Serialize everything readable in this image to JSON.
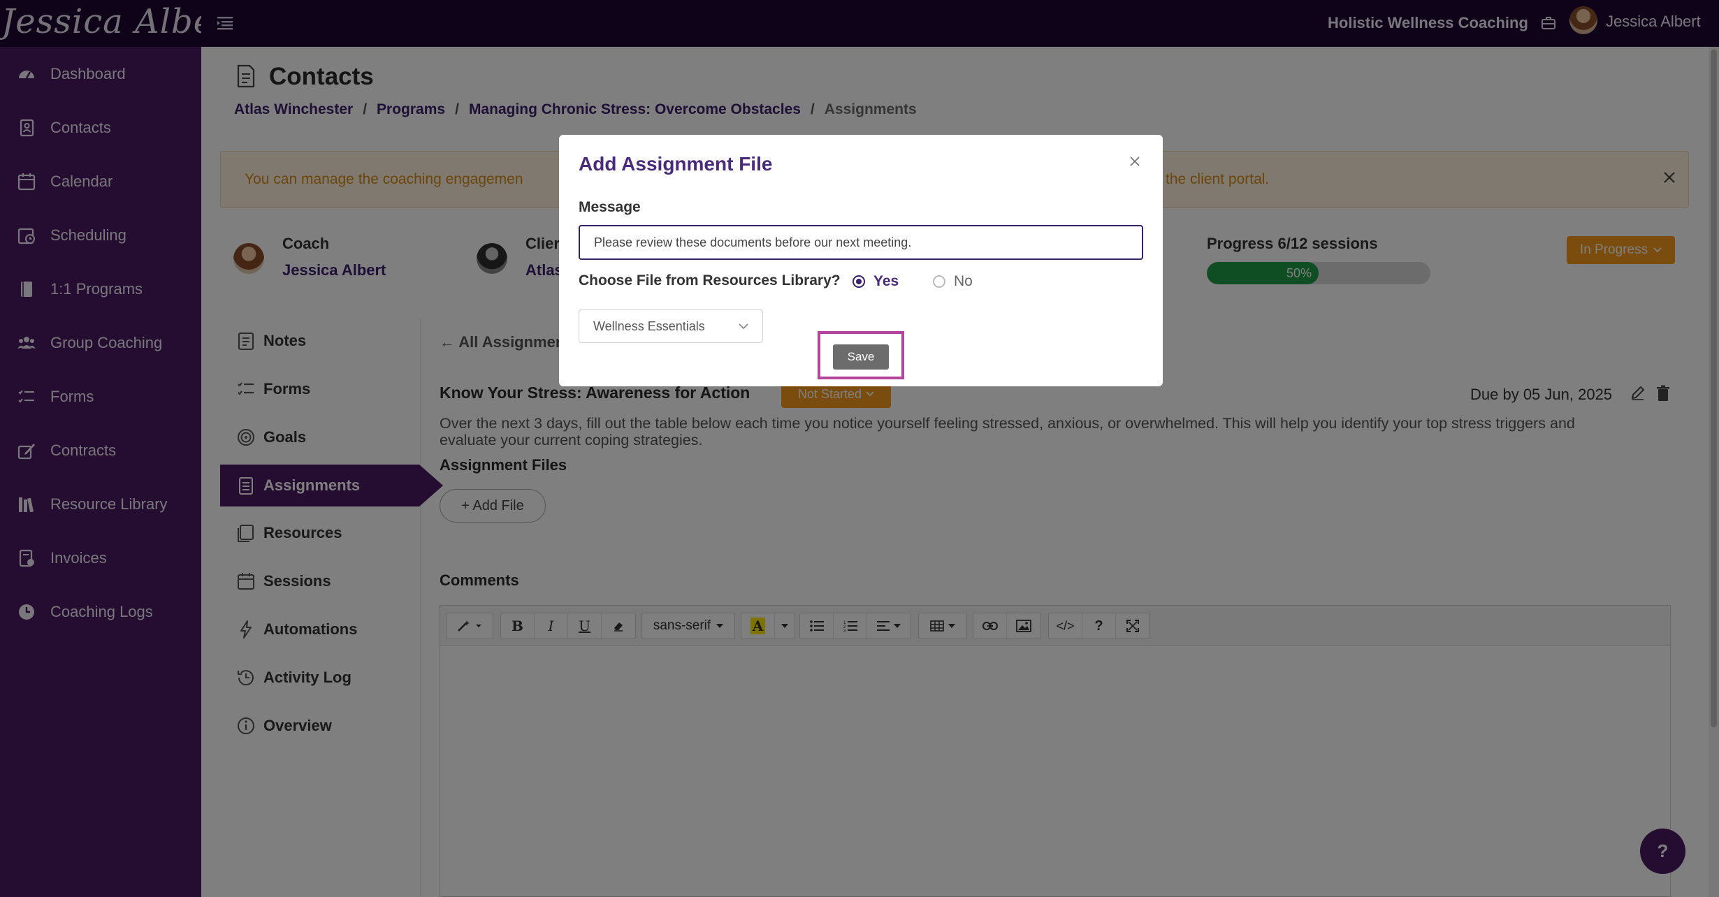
{
  "topbar": {
    "logo_text": "Jessica Albert",
    "org_name": "Holistic Wellness Coaching",
    "user_name": "Jessica Albert"
  },
  "sidebar": {
    "items": [
      {
        "label": "Dashboard",
        "icon": "dashboard-icon"
      },
      {
        "label": "Contacts",
        "icon": "contacts-icon"
      },
      {
        "label": "Calendar",
        "icon": "calendar-icon"
      },
      {
        "label": "Scheduling",
        "icon": "scheduling-icon"
      },
      {
        "label": "1:1 Programs",
        "icon": "book-icon"
      },
      {
        "label": "Group Coaching",
        "icon": "group-icon"
      },
      {
        "label": "Forms",
        "icon": "forms-icon"
      },
      {
        "label": "Contracts",
        "icon": "contract-icon"
      },
      {
        "label": "Resource Library",
        "icon": "library-icon"
      },
      {
        "label": "Invoices",
        "icon": "invoice-icon"
      },
      {
        "label": "Coaching Logs",
        "icon": "clock-icon"
      }
    ]
  },
  "page": {
    "title": "Contacts",
    "breadcrumb": [
      "Atlas Winchester",
      "Programs",
      "Managing Chronic Stress: Overcome Obstacles",
      "Assignments"
    ],
    "breadcrumb_sep": "/",
    "notice_part1": "You can manage the coaching engagemen",
    "notice_part2": "the client portal."
  },
  "engagement": {
    "coach_label": "Coach",
    "coach_name": "Jessica Albert",
    "client_label": "Clier",
    "client_name": "Atlas",
    "progress_label": "Progress 6/12 sessions",
    "progress_value": 50,
    "progress_text": "50%",
    "status": "In Progress"
  },
  "subnav": {
    "items": [
      {
        "label": "Notes",
        "icon": "notes-icon"
      },
      {
        "label": "Forms",
        "icon": "forms-list-icon"
      },
      {
        "label": "Goals",
        "icon": "target-icon"
      },
      {
        "label": "Assignments",
        "icon": "assignment-icon",
        "active": true
      },
      {
        "label": "Resources",
        "icon": "resources-icon"
      },
      {
        "label": "Sessions",
        "icon": "sessions-icon"
      },
      {
        "label": "Automations",
        "icon": "bolt-icon"
      },
      {
        "label": "Activity Log",
        "icon": "history-icon"
      },
      {
        "label": "Overview",
        "icon": "info-icon"
      }
    ]
  },
  "assignment": {
    "back_link": "← All Assignmer",
    "title": "Know Your Stress: Awareness for Action",
    "status": "Not Started",
    "due": "Due by 05 Jun, 2025",
    "description": "Over the next 3 days, fill out the table below each time you notice yourself feeling stressed, anxious, or overwhelmed. This will help you identify your top stress triggers and evaluate your current coping strategies.",
    "files_label": "Assignment Files",
    "add_file": "+ Add File",
    "comments_label": "Comments",
    "editor_font": "sans-serif"
  },
  "modal": {
    "title": "Add Assignment File",
    "message_label": "Message",
    "message_value": "Please review these documents before our next meeting.",
    "choose_label": "Choose File from Resources Library?",
    "yes_label": "Yes",
    "no_label": "No",
    "selected_resource": "Wellness Essentials",
    "save_label": "Save"
  },
  "help": {
    "label": "?"
  }
}
